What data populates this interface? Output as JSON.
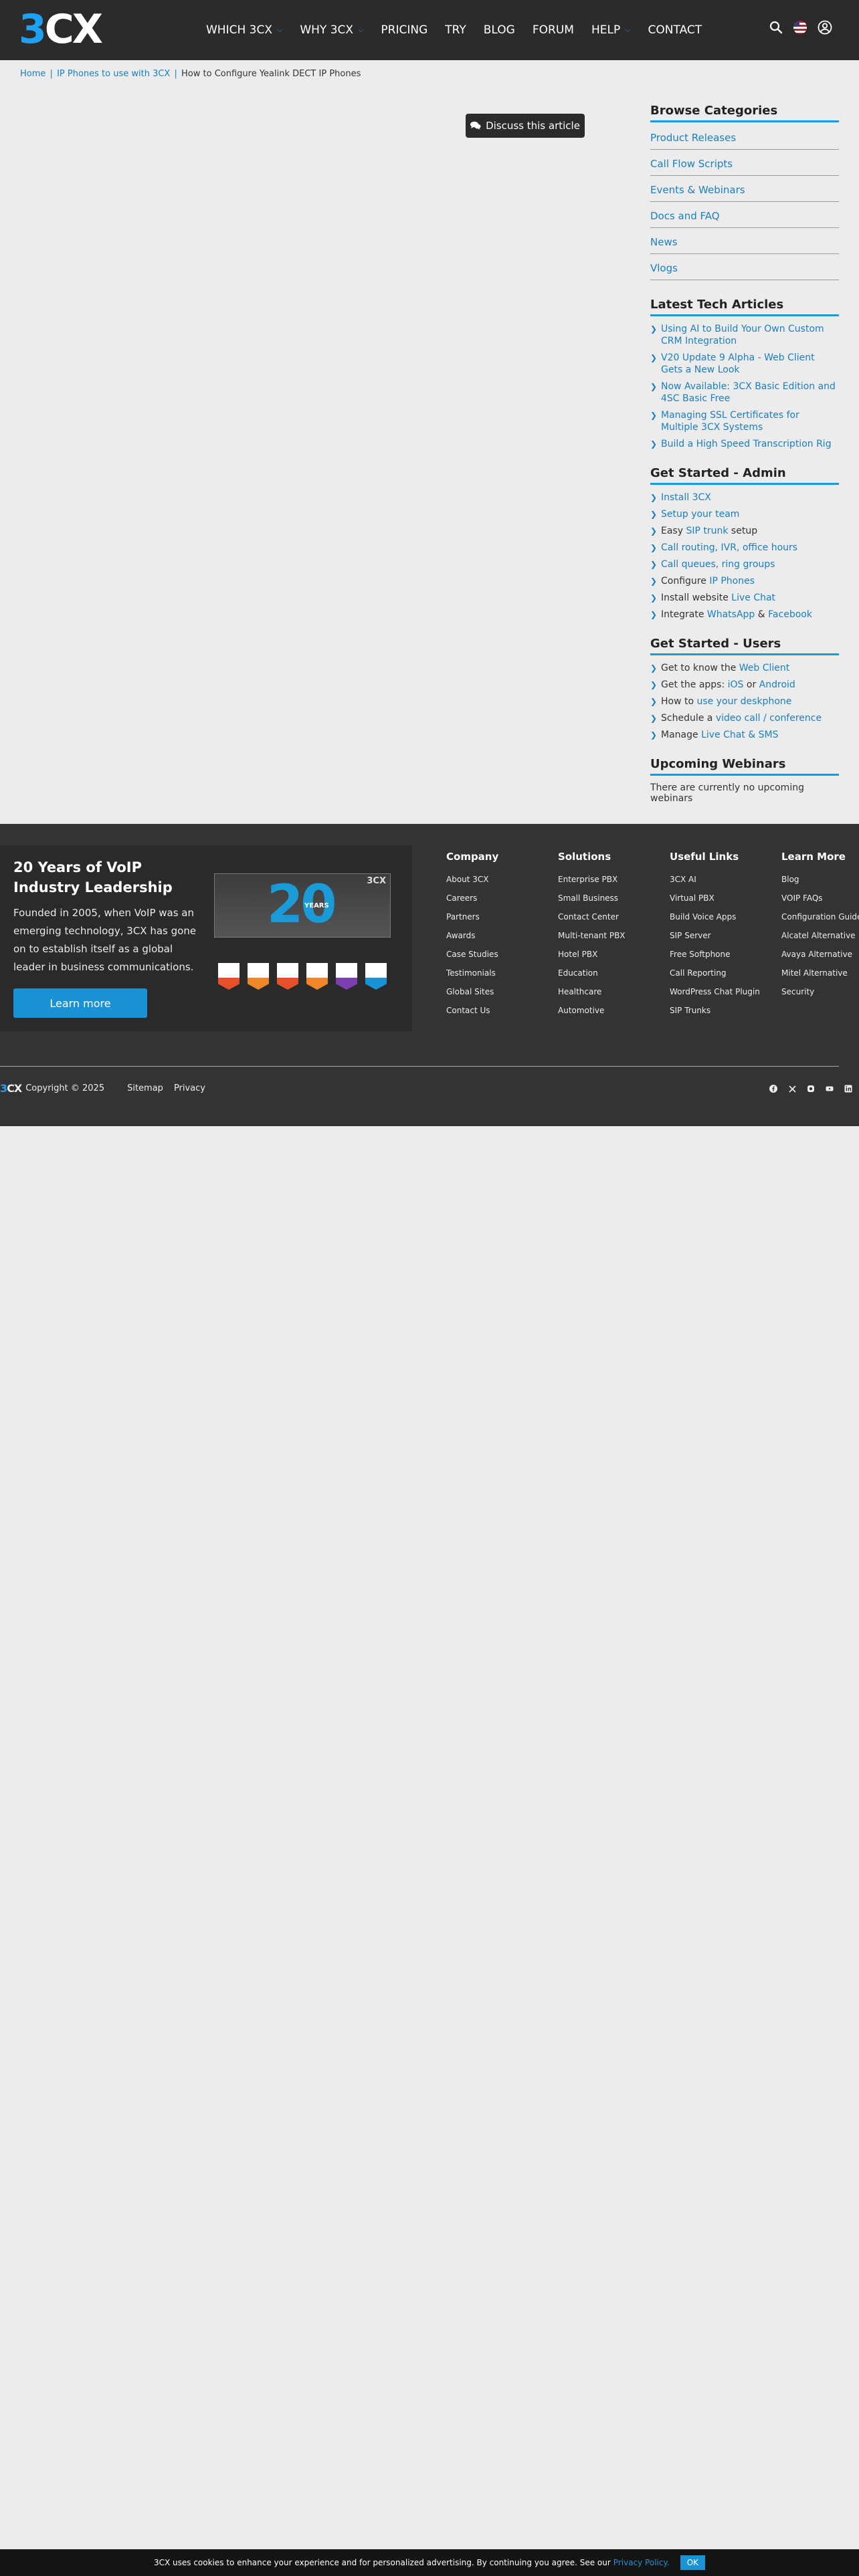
{
  "header": {
    "logo_text_3": "3",
    "logo_text_cx": "CX",
    "nav": [
      {
        "label": "WHICH 3CX",
        "dropdown": true
      },
      {
        "label": "WHY 3CX",
        "dropdown": true
      },
      {
        "label": "PRICING",
        "dropdown": false
      },
      {
        "label": "TRY",
        "dropdown": false
      },
      {
        "label": "BLOG",
        "dropdown": false
      },
      {
        "label": "FORUM",
        "dropdown": false
      },
      {
        "label": "HELP",
        "dropdown": true
      },
      {
        "label": "CONTACT",
        "dropdown": false
      }
    ],
    "icons": [
      "search-icon",
      "us-flag-icon",
      "user-account-icon"
    ]
  },
  "breadcrumb": {
    "home": "Home",
    "sep": "|",
    "section": "IP Phones to use with 3CX",
    "current": "How to Configure Yealink DECT IP Phones"
  },
  "discuss": {
    "label": "Discuss this article",
    "icon": "comments-icon"
  },
  "sidebar": {
    "browse": {
      "title": "Browse Categories",
      "items": [
        "Product Releases",
        "Call Flow Scripts",
        "Events & Webinars",
        "Docs and FAQ",
        "News",
        "Vlogs"
      ]
    },
    "latest": {
      "title": "Latest Tech Articles",
      "items": [
        "Using AI to Build Your Own Custom CRM Integration",
        "V20 Update 9 Alpha - Web Client Gets a New Look",
        "Now Available: 3CX Basic Edition and 4SC Basic Free",
        "Managing SSL Certificates for Multiple 3CX Systems",
        "Build a High Speed Transcription Rig"
      ]
    },
    "admin": {
      "title": "Get Started - Admin",
      "items": [
        {
          "pre": "",
          "link": "Install 3CX",
          "mid": "",
          "link2": "",
          "post": ""
        },
        {
          "pre": "",
          "link": "Setup your team",
          "mid": "",
          "link2": "",
          "post": ""
        },
        {
          "pre": "Easy ",
          "link": "SIP trunk",
          "mid": "",
          "link2": "",
          "post": " setup"
        },
        {
          "pre": "",
          "link": "Call routing, IVR, office hours",
          "mid": "",
          "link2": "",
          "post": ""
        },
        {
          "pre": "",
          "link": "Call queues, ring groups",
          "mid": "",
          "link2": "",
          "post": ""
        },
        {
          "pre": "Configure ",
          "link": "IP Phones",
          "mid": "",
          "link2": "",
          "post": ""
        },
        {
          "pre": "Install website ",
          "link": "Live Chat",
          "mid": "",
          "link2": "",
          "post": ""
        },
        {
          "pre": "Integrate ",
          "link": "WhatsApp",
          "mid": " & ",
          "link2": "Facebook",
          "post": ""
        }
      ]
    },
    "users": {
      "title": "Get Started - Users",
      "items": [
        {
          "pre": "Get to know the ",
          "link": "Web Client",
          "mid": "",
          "link2": "",
          "post": ""
        },
        {
          "pre": "Get the apps: ",
          "link": "iOS",
          "mid": " or ",
          "link2": "Android",
          "post": ""
        },
        {
          "pre": "How to ",
          "link": "use your deskphone",
          "mid": "",
          "link2": "",
          "post": ""
        },
        {
          "pre": "Schedule a ",
          "link": "video call / conference",
          "mid": "",
          "link2": "",
          "post": ""
        },
        {
          "pre": "Manage ",
          "link": "Live Chat & SMS",
          "mid": "",
          "link2": "",
          "post": ""
        }
      ]
    },
    "webinars": {
      "title": "Upcoming Webinars",
      "note": "There are currently no upcoming webinars"
    }
  },
  "footer": {
    "promo": {
      "title": "20 Years of VoIP Industry Leadership",
      "text": "Founded in 2005, when VoIP was an emerging technology, 3CX has gone on to establish itself as a global leader in business communications.",
      "button": "Learn more",
      "image_number": "20",
      "image_word": "YEARS",
      "image_logo": "3CX",
      "badge_colors": [
        "#e8502a",
        "#f0862a",
        "#e8502a",
        "#f0862a",
        "#7b3fb0",
        "#1a93d4"
      ]
    },
    "columns": [
      {
        "title": "Company",
        "links": [
          "About 3CX",
          "Careers",
          "Partners",
          "Awards",
          "Case Studies",
          "Testimonials",
          "Global Sites",
          "Contact Us"
        ]
      },
      {
        "title": "Solutions",
        "links": [
          "Enterprise PBX",
          "Small Business",
          "Contact Center",
          "Multi-tenant PBX",
          "Hotel PBX",
          "Education",
          "Healthcare",
          "Automotive"
        ]
      },
      {
        "title": "Useful Links",
        "links": [
          "3CX AI",
          "Virtual PBX",
          "Build Voice Apps",
          "SIP Server",
          "Free Softphone",
          "Call Reporting",
          "WordPress Chat Plugin",
          "SIP Trunks"
        ]
      },
      {
        "title": "Learn More",
        "links": [
          "Blog",
          "VOIP FAQs",
          "Configuration Guide",
          "Alcatel Alternative",
          "Avaya Alternative",
          "Mitel Alternative",
          "Security"
        ]
      }
    ],
    "copyright": "Copyright © 2025",
    "bottom_links": [
      "Sitemap",
      "Privacy"
    ],
    "social": [
      "facebook-icon",
      "x-icon",
      "instagram-icon",
      "youtube-icon",
      "linkedin-icon"
    ]
  },
  "cookie": {
    "text": "3CX uses cookies to enhance your experience and for personalized advertising. By continuing you agree. See our",
    "link": "Privacy Policy.",
    "ok": "OK"
  },
  "colors": {
    "accent": "#1a93d4",
    "header_bg": "#2b2b2b",
    "footer_bg": "#333333"
  }
}
